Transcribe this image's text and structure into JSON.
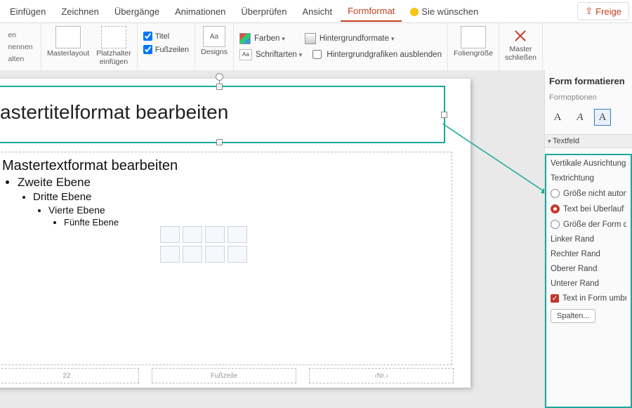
{
  "tabs": {
    "einfuegen": "Einfügen",
    "zeichnen": "Zeichnen",
    "uebergaenge": "Übergänge",
    "animationen": "Animationen",
    "ueberpruefen": "Überprüfen",
    "ansicht": "Ansicht",
    "formformat": "Formformat",
    "wuenschen": "Sie wünschen",
    "freigeben": "Freige"
  },
  "ribbon": {
    "left_group": {
      "line1": "en",
      "line2": "nennen",
      "line3": "alten"
    },
    "masterlayout": "Masterlayout",
    "platzhalter": "Platzhalter\neinfügen",
    "titel": "Titel",
    "fusszeilen": "Fußzeilen",
    "designs": "Designs",
    "farben": "Farben",
    "schriftarten": "Schriftarten",
    "hgformate": "Hintergrundformate",
    "hg_ausblenden": "Hintergrundgrafiken ausblenden",
    "foliengroesse": "Foliengröße",
    "master_schliessen": "Master\nschließen"
  },
  "slide": {
    "title": "astertitelformat bearbeiten",
    "body_lvl1": "Mastertextformat bearbeiten",
    "lvl2": "Zweite Ebene",
    "lvl3": "Dritte Ebene",
    "lvl4": "Vierte Ebene",
    "lvl5": "Fünfte Ebene",
    "footer_date": "22",
    "footer_center": "Fußzeile",
    "footer_num": "‹Nr.›"
  },
  "pane": {
    "title": "Form formatieren",
    "formoptionen": "Formoptionen",
    "section": "Textfeld",
    "vert_align": "Vertikale Ausrichtung",
    "textrichtung": "Textrichtung",
    "radio1": "Größe nicht autom",
    "radio2": "Text bei Überlauf v",
    "radio3": "Größe der Form de",
    "linker": "Linker Rand",
    "rechter": "Rechter Rand",
    "oberer": "Oberer Rand",
    "unterer": "Unterer Rand",
    "wrap": "Text in Form umbr",
    "spalten": "Spalten..."
  }
}
